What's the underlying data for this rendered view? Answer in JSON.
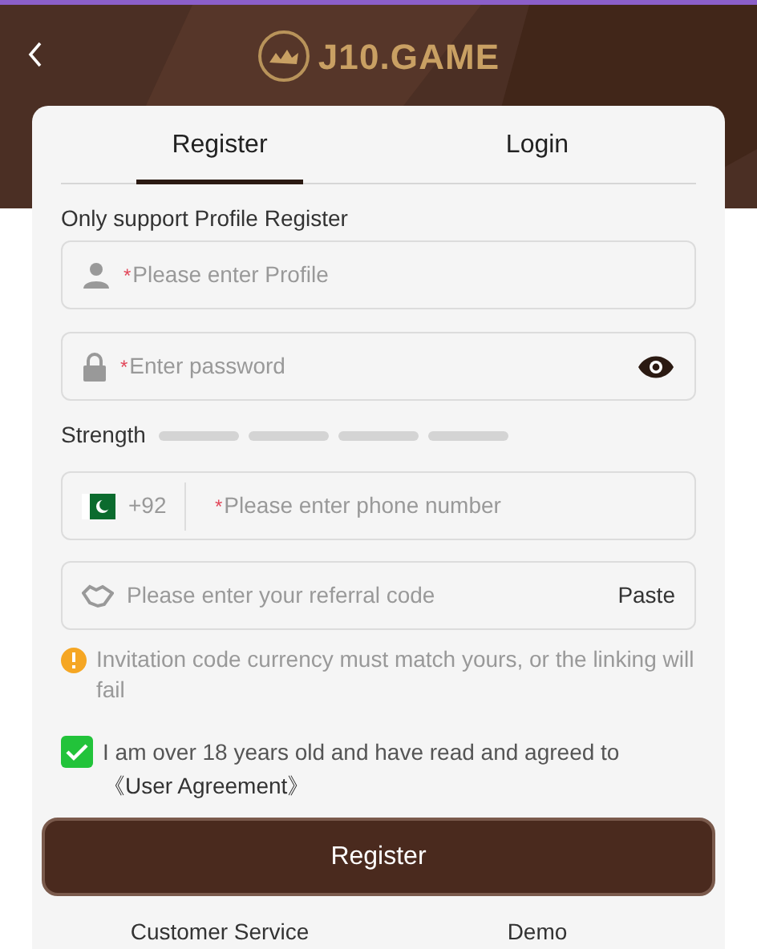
{
  "header": {
    "logo": "J10.GAME"
  },
  "tabs": [
    {
      "label": "Register",
      "selected": true
    },
    {
      "label": "Login",
      "selected": false
    }
  ],
  "notice": "Only support Profile Register",
  "fields": [
    {
      "kind": "profile",
      "placeholder": "Please enter Profile",
      "marker": "*"
    },
    {
      "kind": "password",
      "placeholder": "Enter password",
      "marker": "*"
    },
    {
      "kind": "phone",
      "code": "+92",
      "placeholder": "Please enter phone number",
      "marker": "*"
    },
    {
      "kind": "referral",
      "placeholder": "Please enter your referral code",
      "action": "Paste"
    }
  ],
  "strength": {
    "label": "Strength"
  },
  "warning": "Invitation code currency must match yours, or the linking will fail",
  "agreement": {
    "checked": true,
    "text": "I am over 18 years old and have read and agreed to",
    "link": "《User Agreement》"
  },
  "submit": "Register",
  "footer_links": [
    "Customer Service",
    "Demo"
  ]
}
